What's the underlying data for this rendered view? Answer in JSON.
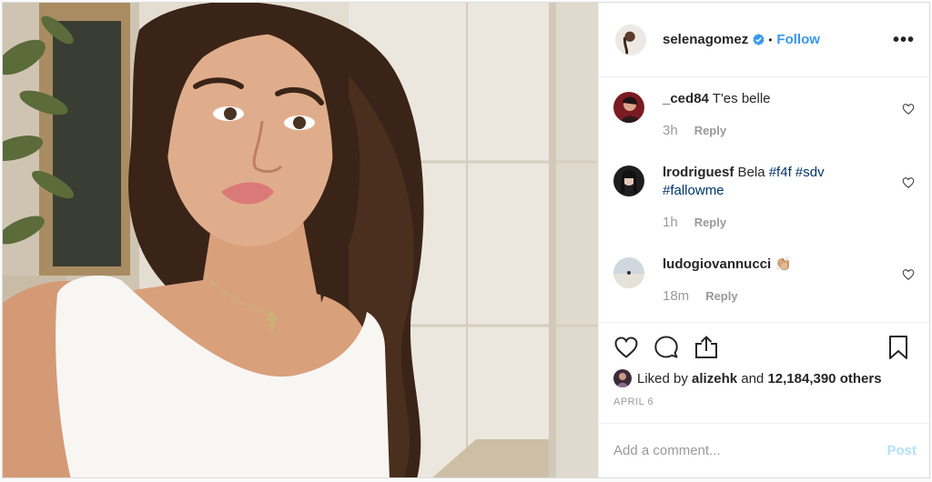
{
  "colors": {
    "accent": "#3897f0",
    "hashtag": "#003569",
    "muted": "#999999",
    "post_disabled": "#b2dffc"
  },
  "header": {
    "username": "selenagomez",
    "verified_icon": "verified-badge-icon",
    "dot": "•",
    "follow_label": "Follow",
    "more_label": "•••"
  },
  "comments": [
    {
      "user": "_ced84",
      "text": "T'es belle",
      "time": "3h",
      "reply_label": "Reply"
    },
    {
      "user": "lrodriguesf",
      "text": "Bela",
      "hashtags": [
        "#f4f",
        "#sdv",
        "#fallowme"
      ],
      "time": "1h",
      "reply_label": "Reply"
    },
    {
      "user": "ludogiovannucci",
      "text": "👏🏼",
      "time": "18m",
      "reply_label": "Reply"
    }
  ],
  "likes": {
    "prefix": "Liked by",
    "user": "alizehk",
    "middle": "and",
    "count": "12,184,390 others"
  },
  "date": "APRIL 6",
  "add_comment": {
    "placeholder": "Add a comment...",
    "post_label": "Post"
  }
}
